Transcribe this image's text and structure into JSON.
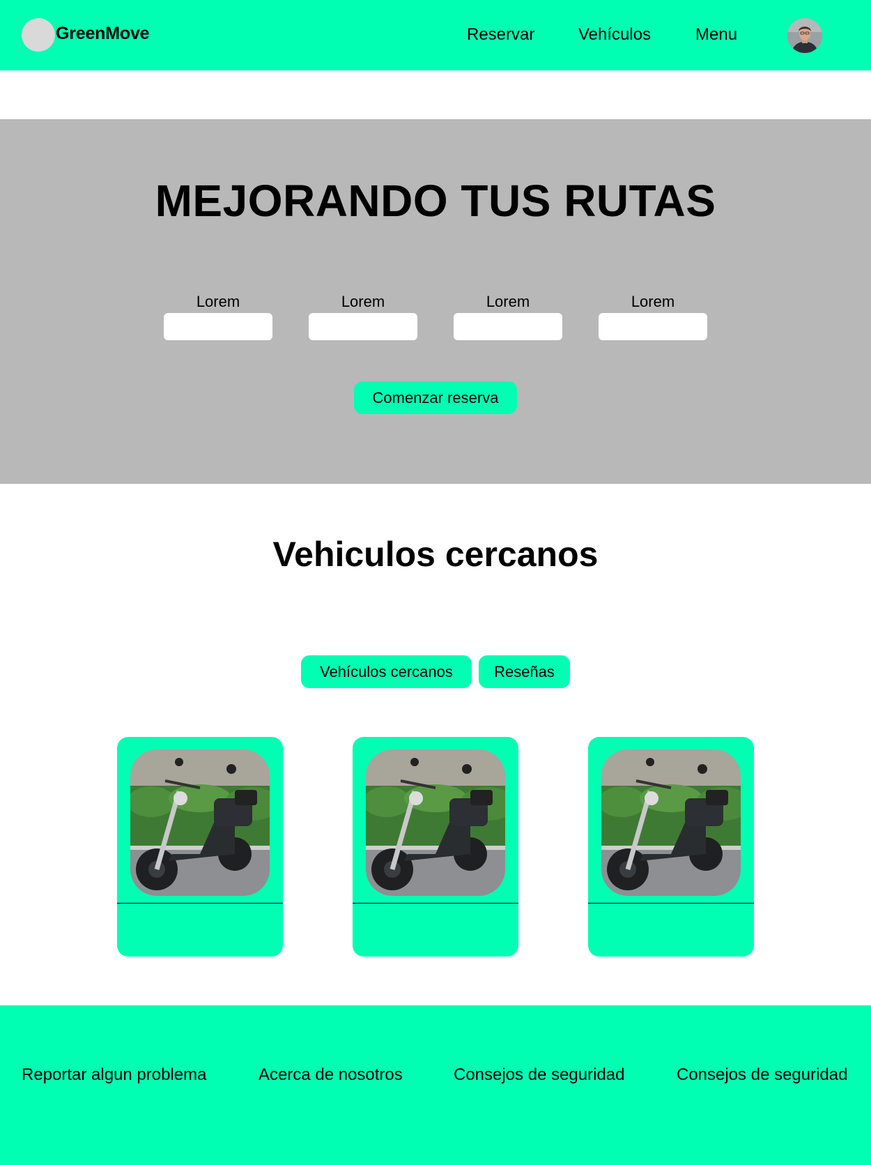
{
  "header": {
    "brand": "GreenMove",
    "nav": [
      "Reservar",
      "Vehículos",
      "Menu"
    ],
    "logo_icon": "logo-placeholder-circle",
    "avatar_icon": "user-avatar"
  },
  "hero": {
    "title": "MEJORANDO TUS RUTAS",
    "fields": [
      {
        "label": "Lorem",
        "value": ""
      },
      {
        "label": "Lorem",
        "value": ""
      },
      {
        "label": "Lorem",
        "value": ""
      },
      {
        "label": "Lorem",
        "value": ""
      }
    ],
    "cta_label": "Comenzar reserva"
  },
  "vehicles": {
    "title": "Vehiculos cercanos",
    "tabs": [
      "Vehículos cercanos",
      "Reseñas"
    ],
    "cards": [
      {
        "image": "electric-scooter-photo"
      },
      {
        "image": "electric-scooter-photo"
      },
      {
        "image": "electric-scooter-photo"
      }
    ]
  },
  "footer": {
    "links": [
      "Reportar algun problema",
      "Acerca de nosotros",
      "Consejos de seguridad",
      "Consejos de seguridad"
    ]
  },
  "colors": {
    "accent": "#00ffb3",
    "hero_bg": "#b8b8b8",
    "logo_placeholder": "#d9d9d9"
  }
}
